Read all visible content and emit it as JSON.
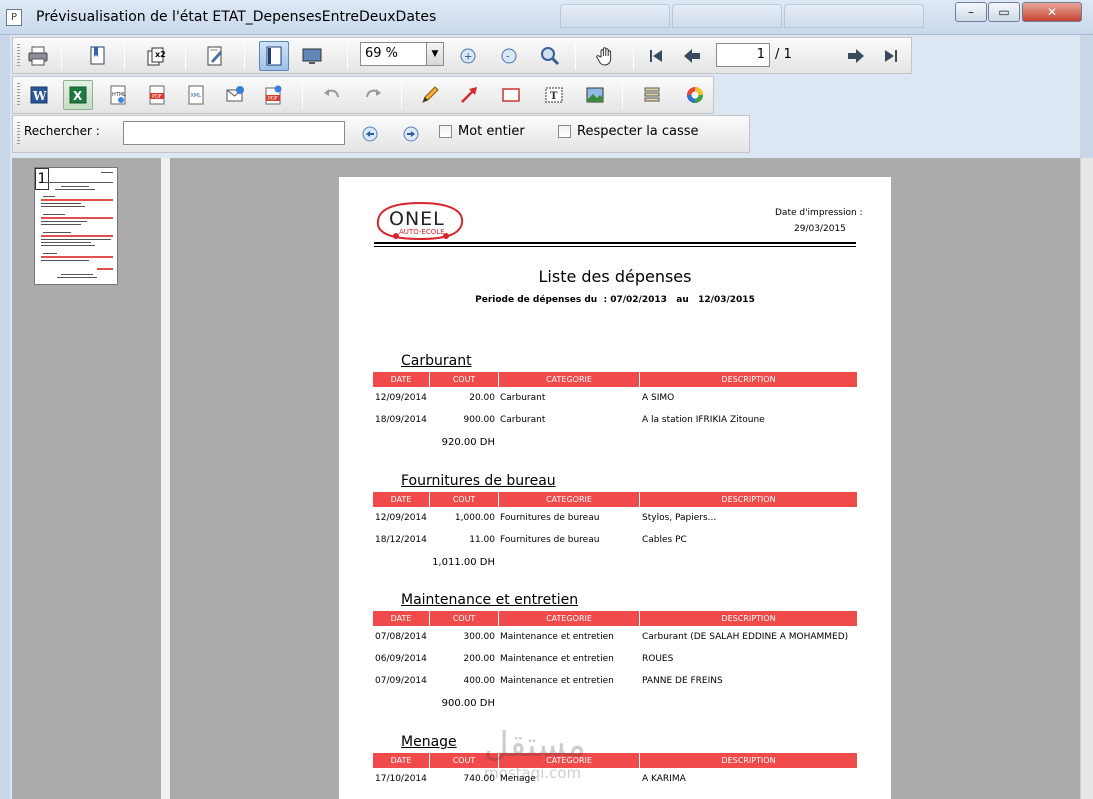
{
  "window": {
    "title": "Prévisualisation de l'état ETAT_DepensesEntreDeuxDates"
  },
  "toolbar": {
    "zoom_value": "69 %",
    "page_current": "1",
    "page_total": "/ 1"
  },
  "search": {
    "label": "Rechercher :",
    "value": "",
    "whole_word_label": "Mot entier",
    "match_case_label": "Respecter la casse"
  },
  "thumbnail": {
    "page_number": "1"
  },
  "report": {
    "logo_text": "ONEL",
    "logo_sub": "AUTO-ECOLE",
    "print_label": "Date d'impression :",
    "print_date": "29/03/2015",
    "title": "Liste des dépenses",
    "period": "Periode de dépenses du  : 07/02/2013   au   12/03/2015",
    "columns": [
      "DATE",
      "COUT",
      "CATEGORIE",
      "DESCRIPTION"
    ],
    "sections": [
      {
        "title": "Carburant",
        "rows": [
          {
            "date": "12/09/2014",
            "cout": "20.00",
            "categorie": "Carburant",
            "description": "A SIMO"
          },
          {
            "date": "18/09/2014",
            "cout": "900.00",
            "categorie": "Carburant",
            "description": "A la station IFRIKIA Zitoune"
          }
        ],
        "total": "920.00 DH"
      },
      {
        "title": "Fournitures de bureau",
        "rows": [
          {
            "date": "12/09/2014",
            "cout": "1,000.00",
            "categorie": "Fournitures de bureau",
            "description": "Stylos, Papiers..."
          },
          {
            "date": "18/12/2014",
            "cout": "11.00",
            "categorie": "Fournitures de bureau",
            "description": "Cables PC"
          }
        ],
        "total": "1,011.00 DH"
      },
      {
        "title": "Maintenance et entretien",
        "rows": [
          {
            "date": "07/08/2014",
            "cout": "300.00",
            "categorie": "Maintenance et entretien",
            "description": "Carburant (DE SALAH EDDINE A MOHAMMED)"
          },
          {
            "date": "06/09/2014",
            "cout": "200.00",
            "categorie": "Maintenance et entretien",
            "description": "ROUES"
          },
          {
            "date": "07/09/2014",
            "cout": "400.00",
            "categorie": "Maintenance et entretien",
            "description": "PANNE DE FREINS"
          }
        ],
        "total": "900.00 DH"
      },
      {
        "title": "Menage",
        "rows": [
          {
            "date": "17/10/2014",
            "cout": "740.00",
            "categorie": "Menage",
            "description": "A KARIMA"
          }
        ],
        "total": ""
      }
    ]
  },
  "colors": {
    "table_header": "#f04a4a",
    "pane_background": "#ababab",
    "logo_red": "#d8242b"
  }
}
